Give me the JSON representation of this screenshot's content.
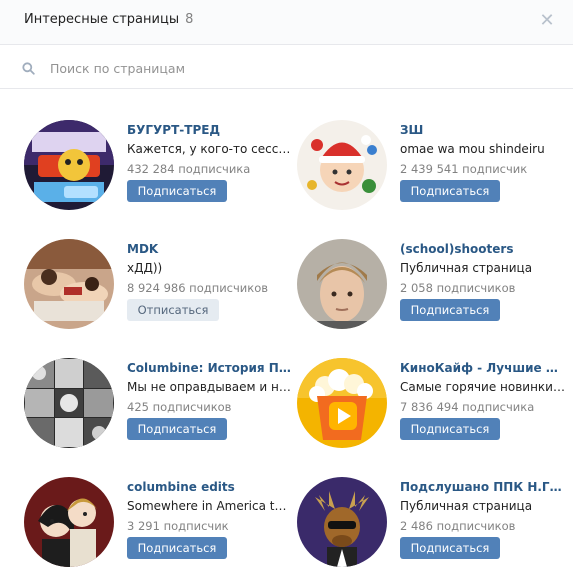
{
  "header": {
    "title": "Интересные страницы",
    "count": "8"
  },
  "search": {
    "placeholder": "Поиск по страницам"
  },
  "pages": [
    {
      "name": "БУГУРТ-ТРЕД",
      "status": "Кажется, у кого-то сесси...",
      "subscribers": "432 284 подписчика",
      "button": "Подписаться",
      "avatar": "bugurt-logo"
    },
    {
      "name": "ЗШ",
      "status": "omae wa mou shindeiru",
      "subscribers": "2 439 541 подписчик",
      "button": "Подписаться",
      "avatar": "santa-hat-boy"
    },
    {
      "name": "MDK",
      "status": "xДД))",
      "subscribers": "8 924 986 подписчиков",
      "button": "Отписаться",
      "avatar": "people-on-bed"
    },
    {
      "name": "(school)shooters",
      "status": "Публичная страница",
      "subscribers": "2 058 подписчиков",
      "button": "Подписаться",
      "avatar": "young-man-portrait"
    },
    {
      "name": "Columbine: История Пр...",
      "status": "Мы не оправдываем и не ...",
      "subscribers": "425 подписчиков",
      "button": "Подписаться",
      "avatar": "photo-collage"
    },
    {
      "name": "КиноКайф - Лучшие фи...",
      "status": "Самые горячие новинки т...",
      "subscribers": "7 836 494 подписчика",
      "button": "Подписаться",
      "avatar": "popcorn-play"
    },
    {
      "name": "columbine edits",
      "status": "Somewhere in America tw...",
      "subscribers": "3 291 подписчик",
      "button": "Подписаться",
      "avatar": "anime-duo"
    },
    {
      "name": "Подслушано ППК Н.Г. С...",
      "status": "Публичная страница",
      "subscribers": "2 486 подписчиков",
      "button": "Подписаться",
      "avatar": "moose-cartoon"
    }
  ],
  "colors": {
    "link": "#2a5885",
    "button": "#5181b8",
    "button_secondary": "#e5ebf1"
  },
  "icons": {
    "close": "close-icon",
    "search": "search-icon"
  }
}
